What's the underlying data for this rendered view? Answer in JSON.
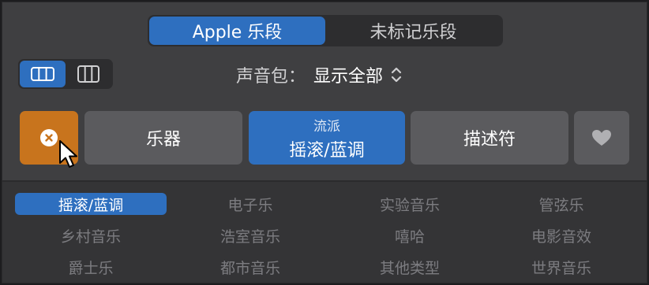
{
  "segments": [
    {
      "label": "Apple 乐段",
      "active": true
    },
    {
      "label": "未标记乐段",
      "active": false
    }
  ],
  "view_toggle": {
    "selected": "list"
  },
  "sound_pack": {
    "label": "声音包：",
    "value": "显示全部"
  },
  "filters": {
    "instrument": {
      "label": "乐器"
    },
    "genre": {
      "category": "流派",
      "value": "摇滚/蓝调"
    },
    "descriptor": {
      "label": "描述符"
    }
  },
  "genres": [
    "摇滚/蓝调",
    "电子乐",
    "实验音乐",
    "管弦乐",
    "乡村音乐",
    "浩室音乐",
    "嘻哈",
    "电影音效",
    "爵士乐",
    "都市音乐",
    "其他类型",
    "世界音乐"
  ],
  "colors": {
    "accent": "#2e6fbf",
    "reset": "#c8741d",
    "panel": "#3f3f41"
  }
}
